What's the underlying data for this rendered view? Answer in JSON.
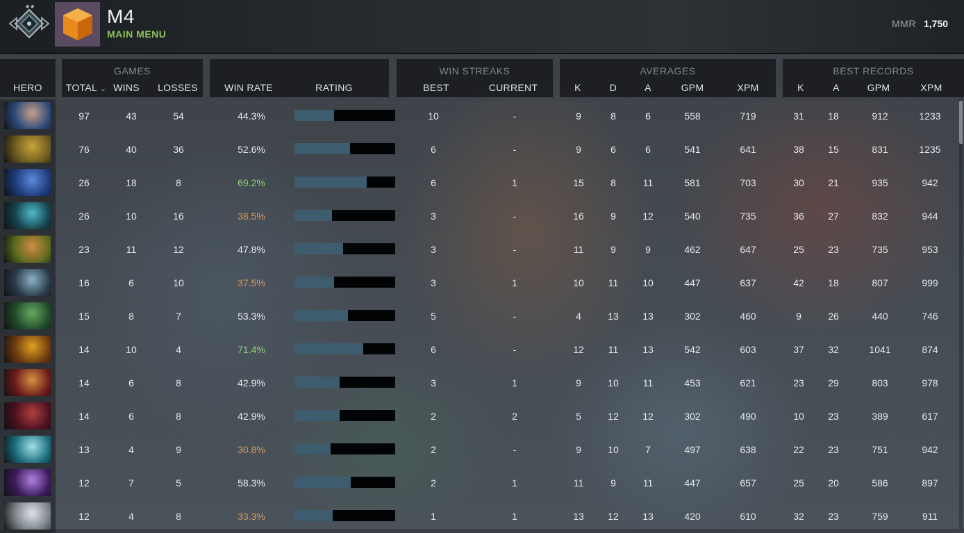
{
  "header": {
    "player_name": "M4",
    "main_menu_label": "MAIN MENU",
    "mmr_label": "MMR",
    "mmr_value": "1,750"
  },
  "table": {
    "hero_header": "HERO",
    "groups": {
      "games": "GAMES",
      "win_streaks": "WIN STREAKS",
      "averages": "AVERAGES",
      "best_records": "BEST RECORDS"
    },
    "columns": {
      "total": "TOTAL",
      "wins": "WINS",
      "losses": "LOSSES",
      "win_rate": "WIN RATE",
      "rating": "RATING",
      "best": "BEST",
      "current": "CURRENT",
      "avg_k": "K",
      "avg_d": "D",
      "avg_a": "A",
      "avg_gpm": "GPM",
      "avg_xpm": "XPM",
      "best_k": "K",
      "best_a": "A",
      "best_gpm": "GPM",
      "best_xpm": "XPM"
    },
    "sort_indicator": "⌄",
    "rows": [
      {
        "hero_icon": "hero-portrait-hooded",
        "c1": "#2b4a7a",
        "c2": "#c7a08a",
        "total": "97",
        "wins": "43",
        "losses": "54",
        "win_rate": "44.3%",
        "rate_class": "",
        "rating": 0.39,
        "best": "10",
        "current": "-",
        "k": "9",
        "d": "8",
        "a": "6",
        "gpm": "558",
        "xpm": "719",
        "bk": "31",
        "ba": "18",
        "bgpm": "912",
        "bxpm": "1233"
      },
      {
        "hero_icon": "hero-portrait-gold-warrior",
        "c1": "#6b5a20",
        "c2": "#c9a33a",
        "total": "76",
        "wins": "40",
        "losses": "36",
        "win_rate": "52.6%",
        "rate_class": "",
        "rating": 0.55,
        "best": "6",
        "current": "-",
        "k": "9",
        "d": "6",
        "a": "6",
        "gpm": "541",
        "xpm": "641",
        "bk": "38",
        "ba": "15",
        "bgpm": "831",
        "bxpm": "1235"
      },
      {
        "hero_icon": "hero-portrait-blue-ghost",
        "c1": "#1d3a7a",
        "c2": "#5a8adb",
        "total": "26",
        "wins": "18",
        "losses": "8",
        "win_rate": "69.2%",
        "rate_class": "good",
        "rating": 0.72,
        "best": "6",
        "current": "1",
        "k": "15",
        "d": "8",
        "a": "11",
        "gpm": "581",
        "xpm": "703",
        "bk": "30",
        "ba": "21",
        "bgpm": "935",
        "bxpm": "942"
      },
      {
        "hero_icon": "hero-portrait-water-spirit",
        "c1": "#14404a",
        "c2": "#4fb8c8",
        "total": "26",
        "wins": "10",
        "losses": "16",
        "win_rate": "38.5%",
        "rate_class": "bad",
        "rating": 0.37,
        "best": "3",
        "current": "-",
        "k": "16",
        "d": "9",
        "a": "12",
        "gpm": "540",
        "xpm": "735",
        "bk": "36",
        "ba": "27",
        "bgpm": "832",
        "bxpm": "944"
      },
      {
        "hero_icon": "hero-portrait-redhead",
        "c1": "#5a6a20",
        "c2": "#d08a40",
        "total": "23",
        "wins": "11",
        "losses": "12",
        "win_rate": "47.8%",
        "rate_class": "",
        "rating": 0.48,
        "best": "3",
        "current": "-",
        "k": "11",
        "d": "9",
        "a": "9",
        "gpm": "462",
        "xpm": "647",
        "bk": "25",
        "ba": "23",
        "bgpm": "735",
        "bxpm": "953"
      },
      {
        "hero_icon": "hero-portrait-masked-blue",
        "c1": "#2a3a4a",
        "c2": "#8ab0c8",
        "total": "16",
        "wins": "6",
        "losses": "10",
        "win_rate": "37.5%",
        "rate_class": "bad",
        "rating": 0.39,
        "best": "3",
        "current": "1",
        "k": "10",
        "d": "11",
        "a": "10",
        "gpm": "447",
        "xpm": "637",
        "bk": "42",
        "ba": "18",
        "bgpm": "807",
        "bxpm": "999"
      },
      {
        "hero_icon": "hero-portrait-green-soldier",
        "c1": "#1f4a2a",
        "c2": "#6aa860",
        "total": "15",
        "wins": "8",
        "losses": "7",
        "win_rate": "53.3%",
        "rate_class": "",
        "rating": 0.53,
        "best": "5",
        "current": "-",
        "k": "4",
        "d": "13",
        "a": "13",
        "gpm": "302",
        "xpm": "460",
        "bk": "9",
        "ba": "26",
        "bgpm": "440",
        "bxpm": "746"
      },
      {
        "hero_icon": "hero-portrait-fire-lord",
        "c1": "#6a3a10",
        "c2": "#e0a020",
        "total": "14",
        "wins": "10",
        "losses": "4",
        "win_rate": "71.4%",
        "rate_class": "good",
        "rating": 0.68,
        "best": "6",
        "current": "-",
        "k": "12",
        "d": "11",
        "a": "13",
        "gpm": "542",
        "xpm": "603",
        "bk": "37",
        "ba": "32",
        "bgpm": "1041",
        "bxpm": "874"
      },
      {
        "hero_icon": "hero-portrait-red-gold",
        "c1": "#6a1a1a",
        "c2": "#d89040",
        "total": "14",
        "wins": "6",
        "losses": "8",
        "win_rate": "42.9%",
        "rate_class": "",
        "rating": 0.45,
        "best": "3",
        "current": "1",
        "k": "9",
        "d": "10",
        "a": "11",
        "gpm": "453",
        "xpm": "621",
        "bk": "23",
        "ba": "29",
        "bgpm": "803",
        "bxpm": "978"
      },
      {
        "hero_icon": "hero-portrait-demon",
        "c1": "#4a1020",
        "c2": "#b04040",
        "total": "14",
        "wins": "6",
        "losses": "8",
        "win_rate": "42.9%",
        "rate_class": "",
        "rating": 0.45,
        "best": "2",
        "current": "2",
        "k": "5",
        "d": "12",
        "a": "12",
        "gpm": "302",
        "xpm": "490",
        "bk": "10",
        "ba": "23",
        "bgpm": "389",
        "bxpm": "617"
      },
      {
        "hero_icon": "hero-portrait-wave",
        "c1": "#1a6a7a",
        "c2": "#a0e0e8",
        "total": "13",
        "wins": "4",
        "losses": "9",
        "win_rate": "30.8%",
        "rate_class": "bad",
        "rating": 0.36,
        "best": "2",
        "current": "-",
        "k": "9",
        "d": "10",
        "a": "7",
        "gpm": "497",
        "xpm": "638",
        "bk": "22",
        "ba": "23",
        "bgpm": "751",
        "bxpm": "942"
      },
      {
        "hero_icon": "hero-portrait-void",
        "c1": "#3a1a5a",
        "c2": "#b080e0",
        "total": "12",
        "wins": "7",
        "losses": "5",
        "win_rate": "58.3%",
        "rate_class": "",
        "rating": 0.56,
        "best": "2",
        "current": "1",
        "k": "11",
        "d": "9",
        "a": "11",
        "gpm": "447",
        "xpm": "657",
        "bk": "25",
        "ba": "20",
        "bgpm": "586",
        "bxpm": "897"
      },
      {
        "hero_icon": "hero-portrait-white-beast",
        "c1": "#7a8088",
        "c2": "#dfe3e8",
        "total": "12",
        "wins": "4",
        "losses": "8",
        "win_rate": "33.3%",
        "rate_class": "bad",
        "rating": 0.38,
        "best": "1",
        "current": "1",
        "k": "13",
        "d": "12",
        "a": "13",
        "gpm": "420",
        "xpm": "610",
        "bk": "32",
        "ba": "23",
        "bgpm": "759",
        "bxpm": "911"
      }
    ]
  },
  "colors": {
    "accent_green": "#8fc25a",
    "rating_fill": "#3d5c6e",
    "rate_good": "#8fcf76",
    "rate_bad": "#cf9b62"
  }
}
